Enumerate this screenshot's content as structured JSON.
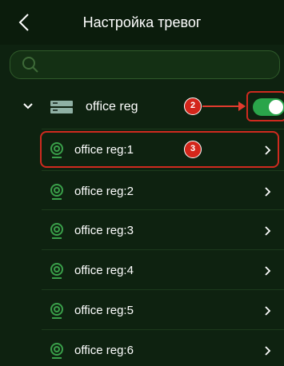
{
  "header": {
    "title": "Настройка тревог"
  },
  "search": {
    "placeholder": "",
    "value": ""
  },
  "group": {
    "label": "office reg",
    "toggle_on": true,
    "expanded": true
  },
  "annotations": [
    "2",
    "3"
  ],
  "channels": [
    {
      "label": "office reg:1"
    },
    {
      "label": "office reg:2"
    },
    {
      "label": "office reg:3"
    },
    {
      "label": "office reg:4"
    },
    {
      "label": "office reg:5"
    },
    {
      "label": "office reg:6"
    }
  ],
  "colors": {
    "background": "#0e2210",
    "header": "#0b1c0c",
    "accent": "#2aa54a",
    "highlight": "#cf2a1f"
  },
  "icons": [
    "back-icon",
    "search-icon",
    "chevron-down-icon",
    "recorder-icon",
    "camera-icon",
    "chevron-right-icon"
  ]
}
